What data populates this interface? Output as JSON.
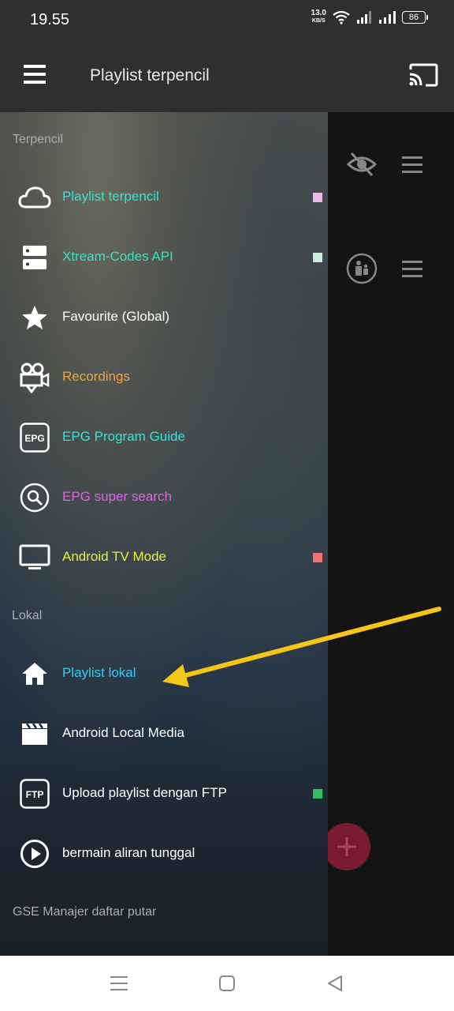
{
  "status": {
    "time": "19.55",
    "net_speed": "13.0",
    "net_unit": "KB/S",
    "battery": "86"
  },
  "appbar": {
    "title": "Playlist terpencil"
  },
  "drawer": {
    "section_remote": "Terpencil",
    "section_local": "Lokal",
    "section_gse": "GSE Manajer daftar putar",
    "remote_items": [
      {
        "label": "Playlist terpencil",
        "color": "#2ee6d8",
        "icon": "cloud-icon",
        "badge": "#f0b8e8"
      },
      {
        "label": "Xtream-Codes API",
        "color": "#2ee6c4",
        "icon": "server-icon",
        "badge": "#c8f0dc"
      },
      {
        "label": "Favourite (Global)",
        "color": "#ffffff",
        "icon": "star-icon"
      },
      {
        "label": "Recordings",
        "color": "#f0a040",
        "icon": "video-camera-icon"
      },
      {
        "label": "EPG Program Guide",
        "color": "#2ee6d8",
        "icon": "epg-icon",
        "icon_text": "EPG"
      },
      {
        "label": "EPG super search",
        "color": "#e060e8",
        "icon": "search-circle-icon"
      },
      {
        "label": "Android TV Mode",
        "color": "#e8f040",
        "icon": "tv-icon",
        "badge": "#f07070"
      }
    ],
    "local_items": [
      {
        "label": "Playlist lokal",
        "color": "#38c8f0",
        "icon": "home-icon"
      },
      {
        "label": "Android Local Media",
        "color": "#ffffff",
        "icon": "clapperboard-icon"
      },
      {
        "label": "Upload playlist dengan FTP",
        "color": "#ffffff",
        "icon": "ftp-icon",
        "icon_text": "FTP",
        "badge": "#30c060"
      },
      {
        "label": "bermain aliran tunggal",
        "color": "#ffffff",
        "icon": "play-circle-icon"
      }
    ]
  },
  "annotation_arrow_color": "#f5c518"
}
